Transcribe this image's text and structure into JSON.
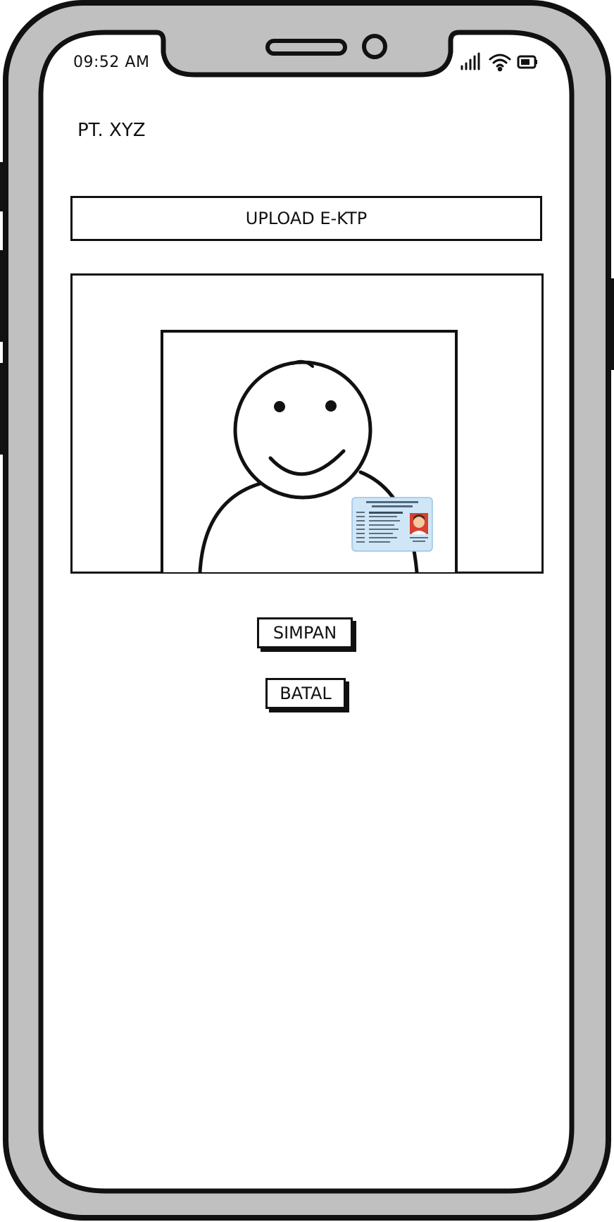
{
  "status_bar": {
    "time": "09:52 AM",
    "icons": [
      "signal-icon",
      "wifi-icon",
      "battery-icon"
    ]
  },
  "header": {
    "company": "PT. XYZ"
  },
  "upload": {
    "label": "UPLOAD E-KTP"
  },
  "preview": {
    "icon": "person-with-id-card-icon"
  },
  "actions": {
    "save_label": "SIMPAN",
    "cancel_label": "BATAL"
  }
}
